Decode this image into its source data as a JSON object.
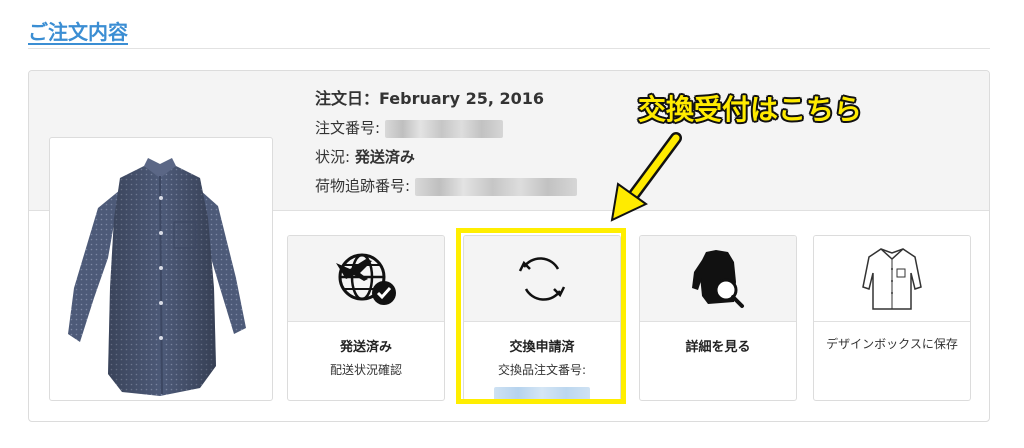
{
  "page": {
    "section_title": "ご注文内容"
  },
  "order": {
    "date_label": "注文日：",
    "date_value": "February 25, 2016",
    "number_label": "注文番号:",
    "status_label": "状況:",
    "status_value": "発送済み",
    "tracking_label": "荷物追跡番号:"
  },
  "product": {
    "image_name": "shirt-image"
  },
  "actions": [
    {
      "icon": "shipping-globe-icon",
      "label": "発送済み",
      "sub": "配送状況確認"
    },
    {
      "icon": "exchange-refresh-icon",
      "label": "交換申請済",
      "sub": "交換品注文番号:"
    },
    {
      "icon": "shirt-search-icon",
      "label": "詳細を見る"
    },
    {
      "icon": "shirt-outline-icon",
      "label": "デザインボックスに保存"
    }
  ],
  "annotation": {
    "callout_text": "交換受付はこちら",
    "highlight_color": "#ffee00",
    "callout_color": "#ffeb00"
  },
  "colors": {
    "link": "#3b8ed3",
    "panel_bg": "#f4f4f4",
    "border": "#dcdcdc"
  }
}
